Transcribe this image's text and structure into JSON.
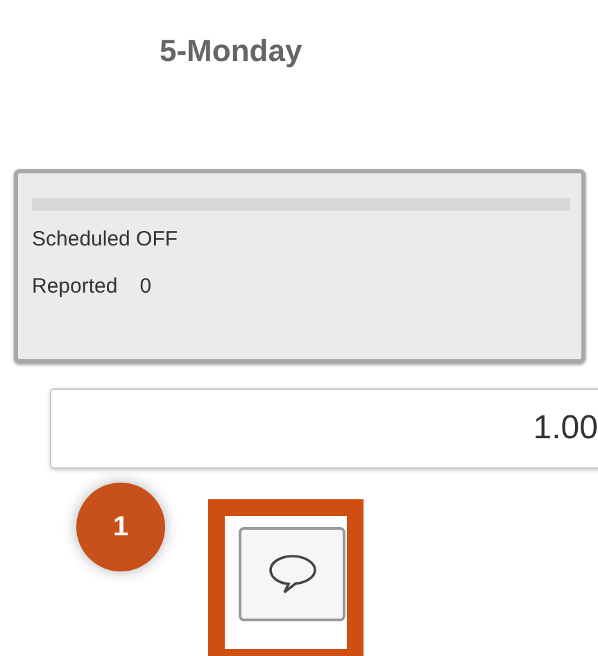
{
  "day_title": "5-Monday",
  "day_card": {
    "scheduled": "Scheduled OFF",
    "reported_label": "Reported",
    "reported_value": "0"
  },
  "hours_field": {
    "value": "1.00"
  },
  "callout": {
    "number": "1"
  },
  "comment_button": {
    "highlighted": true
  }
}
